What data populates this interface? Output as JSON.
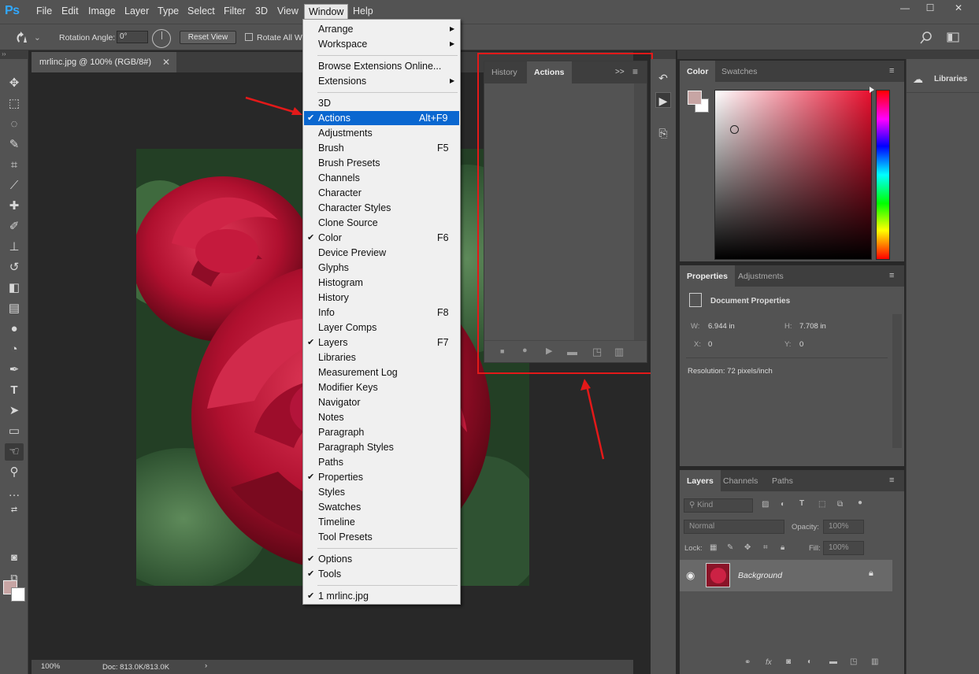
{
  "app": {
    "logo": "Ps"
  },
  "menubar": {
    "items": [
      "File",
      "Edit",
      "Image",
      "Layer",
      "Type",
      "Select",
      "Filter",
      "3D",
      "View",
      "Window",
      "Help"
    ],
    "window_controls": [
      "—",
      "☐",
      "✕"
    ]
  },
  "options_bar": {
    "rotation_label": "Rotation Angle:",
    "rotation_value": "0°",
    "reset_view": "Reset View",
    "rotate_all": "Rotate All Wi"
  },
  "document": {
    "tab_title": "mrlinc.jpg @ 100% (RGB/8#)",
    "tab_close": "✕",
    "zoom": "100%",
    "doc_size": "Doc: 813.0K/813.0K",
    "status_arrow": "›"
  },
  "window_menu": {
    "items": [
      {
        "label": "Arrange",
        "arrow": "▶",
        "checked": false,
        "shortcut": ""
      },
      {
        "label": "Workspace",
        "arrow": "▶",
        "checked": false,
        "shortcut": ""
      },
      {
        "label": "Browse Extensions Online...",
        "arrow": "",
        "checked": false,
        "shortcut": "",
        "sep_before": true
      },
      {
        "label": "Extensions",
        "arrow": "▶",
        "checked": false,
        "shortcut": ""
      },
      {
        "label": "3D",
        "arrow": "",
        "checked": false,
        "shortcut": "",
        "sep_before": true
      },
      {
        "label": "Actions",
        "arrow": "",
        "checked": true,
        "shortcut": "Alt+F9",
        "highlighted": true
      },
      {
        "label": "Adjustments",
        "arrow": "",
        "checked": false,
        "shortcut": ""
      },
      {
        "label": "Brush",
        "arrow": "",
        "checked": false,
        "shortcut": "F5"
      },
      {
        "label": "Brush Presets",
        "arrow": "",
        "checked": false,
        "shortcut": ""
      },
      {
        "label": "Channels",
        "arrow": "",
        "checked": false,
        "shortcut": ""
      },
      {
        "label": "Character",
        "arrow": "",
        "checked": false,
        "shortcut": ""
      },
      {
        "label": "Character Styles",
        "arrow": "",
        "checked": false,
        "shortcut": ""
      },
      {
        "label": "Clone Source",
        "arrow": "",
        "checked": false,
        "shortcut": ""
      },
      {
        "label": "Color",
        "arrow": "",
        "checked": true,
        "shortcut": "F6"
      },
      {
        "label": "Device Preview",
        "arrow": "",
        "checked": false,
        "shortcut": ""
      },
      {
        "label": "Glyphs",
        "arrow": "",
        "checked": false,
        "shortcut": ""
      },
      {
        "label": "Histogram",
        "arrow": "",
        "checked": false,
        "shortcut": ""
      },
      {
        "label": "History",
        "arrow": "",
        "checked": false,
        "shortcut": ""
      },
      {
        "label": "Info",
        "arrow": "",
        "checked": false,
        "shortcut": "F8"
      },
      {
        "label": "Layer Comps",
        "arrow": "",
        "checked": false,
        "shortcut": ""
      },
      {
        "label": "Layers",
        "arrow": "",
        "checked": true,
        "shortcut": "F7"
      },
      {
        "label": "Libraries",
        "arrow": "",
        "checked": false,
        "shortcut": ""
      },
      {
        "label": "Measurement Log",
        "arrow": "",
        "checked": false,
        "shortcut": ""
      },
      {
        "label": "Modifier Keys",
        "arrow": "",
        "checked": false,
        "shortcut": ""
      },
      {
        "label": "Navigator",
        "arrow": "",
        "checked": false,
        "shortcut": ""
      },
      {
        "label": "Notes",
        "arrow": "",
        "checked": false,
        "shortcut": ""
      },
      {
        "label": "Paragraph",
        "arrow": "",
        "checked": false,
        "shortcut": ""
      },
      {
        "label": "Paragraph Styles",
        "arrow": "",
        "checked": false,
        "shortcut": ""
      },
      {
        "label": "Paths",
        "arrow": "",
        "checked": false,
        "shortcut": ""
      },
      {
        "label": "Properties",
        "arrow": "",
        "checked": true,
        "shortcut": ""
      },
      {
        "label": "Styles",
        "arrow": "",
        "checked": false,
        "shortcut": ""
      },
      {
        "label": "Swatches",
        "arrow": "",
        "checked": false,
        "shortcut": ""
      },
      {
        "label": "Timeline",
        "arrow": "",
        "checked": false,
        "shortcut": ""
      },
      {
        "label": "Tool Presets",
        "arrow": "",
        "checked": false,
        "shortcut": ""
      },
      {
        "label": "Options",
        "arrow": "",
        "checked": true,
        "shortcut": "",
        "sep_before": true
      },
      {
        "label": "Tools",
        "arrow": "",
        "checked": true,
        "shortcut": ""
      },
      {
        "label": "1 mrlinc.jpg",
        "arrow": "",
        "checked": true,
        "shortcut": "",
        "sep_before": true
      }
    ],
    "check_glyph": "✔"
  },
  "actions_panel": {
    "tabs": [
      "History",
      "Actions"
    ],
    "active_tab": "Actions",
    "expand_glyph": ">>",
    "menu_glyph": "≡"
  },
  "color_panel": {
    "tabs": [
      "Color",
      "Swatches"
    ],
    "foreground": "#c7a5a4",
    "background": "#ffffff"
  },
  "properties_panel": {
    "tabs": [
      "Properties",
      "Adjustments"
    ],
    "title": "Document Properties",
    "w_label": "W:",
    "w_value": "6.944 in",
    "h_label": "H:",
    "h_value": "7.708 in",
    "x_label": "X:",
    "x_value": "0",
    "y_label": "Y:",
    "y_value": "0",
    "resolution": "Resolution: 72 pixels/inch"
  },
  "layers_panel": {
    "tabs": [
      "Layers",
      "Channels",
      "Paths"
    ],
    "filter_placeholder": "Kind",
    "blend_mode": "Normal",
    "opacity_label": "Opacity:",
    "opacity_value": "100%",
    "lock_label": "Lock:",
    "fill_label": "Fill:",
    "fill_value": "100%",
    "layer_name": "Background",
    "footer_fx": "fx"
  },
  "libraries_panel": {
    "title": "Libraries"
  },
  "colors": {
    "accent": "#0a67d0",
    "annotation": "#e31919"
  }
}
